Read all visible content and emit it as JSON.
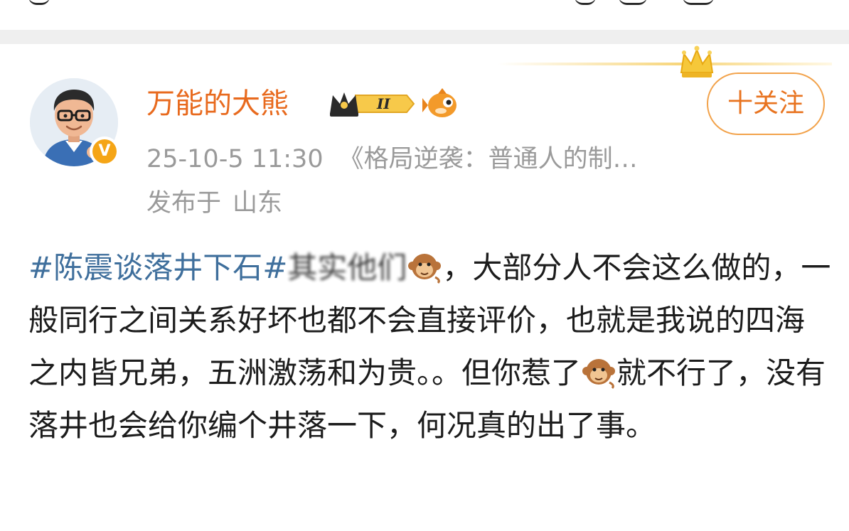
{
  "post": {
    "author": "万能的大熊",
    "follow_label": "十关注",
    "time": "25-10-5 11:30",
    "source": "《格局逆袭：普通人的制…",
    "location_prefix": "发布于",
    "location": "山东",
    "hashtag": "#陈震谈落井下石#",
    "text_1": "其实他们",
    "text_2": "，大部分人不会这么做的，一般同行之间关系好坏也都不会直接评价，也就是我说的四海之内皆兄弟，五洲激荡和为贵。。但你惹了",
    "text_3": "就不行了，没有落井也会给你编个井落一下，何况真的出了事。",
    "emoji": "monkey-emoji"
  },
  "badges": {
    "verified": "V",
    "vip_level": "II"
  },
  "colors": {
    "author": "#e86a1e",
    "hashtag": "#3f6f9c",
    "meta": "#9a9a9a",
    "follow_border": "#f2a24a",
    "verified": "#f5a516"
  }
}
